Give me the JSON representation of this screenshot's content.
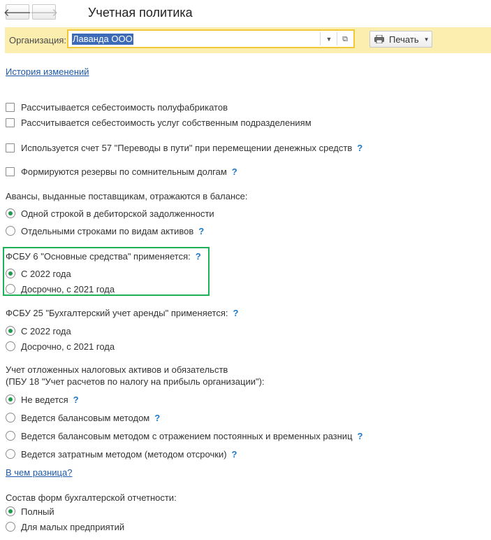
{
  "window": {
    "title": "Учетная политика"
  },
  "nav": {
    "back_glyph": "🡐",
    "forward_glyph": "🡒"
  },
  "org": {
    "label": "Организация:",
    "value": "Лаванда ООО",
    "dropdown_glyph": "▼",
    "open_glyph": "⧉"
  },
  "toolbar": {
    "print_label": "Печать",
    "print_caret": "▼"
  },
  "links": {
    "history": "История изменений",
    "difference": "В чем разница?"
  },
  "help_glyph": "?",
  "checkboxes": [
    {
      "label": "Рассчитывается себестоимость полуфабрикатов",
      "checked": false
    },
    {
      "label": "Рассчитывается себестоимость услуг собственным подразделениям",
      "checked": false
    },
    {
      "label": "Используется счет 57 \"Переводы в пути\" при перемещении денежных средств",
      "checked": false
    },
    {
      "label": "Формируются резервы по сомнительным долгам",
      "checked": false
    }
  ],
  "advances": {
    "title": "Авансы, выданные поставщикам, отражаются в балансе:",
    "options": [
      "Одной строкой в дебиторской задолженности",
      "Отдельными строками по видам активов"
    ],
    "selected": 0
  },
  "fsbu6": {
    "title": "ФСБУ 6 \"Основные средства\" применяется:",
    "options": [
      "С 2022 года",
      "Досрочно, с 2021 года"
    ],
    "selected": 0
  },
  "fsbu25": {
    "title": "ФСБУ 25 \"Бухгалтерский учет аренды\" применяется:",
    "options": [
      "С 2022 года",
      "Досрочно, с 2021 года"
    ],
    "selected": 0
  },
  "pbu18": {
    "title_line1": "Учет отложенных налоговых активов и обязательств",
    "title_line2": "(ПБУ 18 \"Учет расчетов по налогу на прибыль организации\"):",
    "options": [
      "Не ведется",
      "Ведется балансовым методом",
      "Ведется балансовым методом с отражением постоянных и временных разниц",
      "Ведется затратным методом (методом отсрочки)"
    ],
    "selected": 0
  },
  "forms": {
    "title": "Состав форм бухгалтерской отчетности:",
    "options": [
      "Полный",
      "Для малых предприятий"
    ],
    "selected": 0
  },
  "colors": {
    "accent_green": "#1fb05a",
    "link_blue": "#1e5aa8",
    "org_bar": "#fbeeaf",
    "field_border": "#f1c838"
  }
}
